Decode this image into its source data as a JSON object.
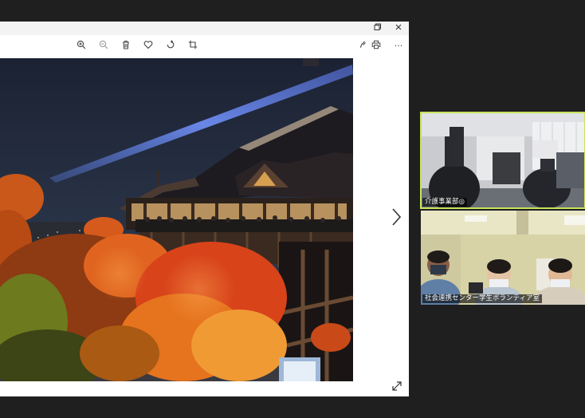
{
  "window": {
    "restore_icon": "restore-icon",
    "close_icon": "close-icon"
  },
  "toolbar": {
    "icons": [
      "zoom-in-icon",
      "zoom-out-icon",
      "delete-icon",
      "favorite-icon",
      "rotate-icon",
      "crop-icon",
      "edit-icon",
      "print-icon",
      "more-icon"
    ],
    "more_label": "···"
  },
  "participants": [
    {
      "name": "介護事業部",
      "suffix": "◎",
      "highlighted": true,
      "highlight_color": "#c6e35b"
    },
    {
      "name": "社会連携センター学生ボランティア室",
      "highlighted": false
    }
  ],
  "colors": {
    "background": "#1f1f1f",
    "viewer": "#ffffff",
    "highlight": "#c6e35b"
  }
}
